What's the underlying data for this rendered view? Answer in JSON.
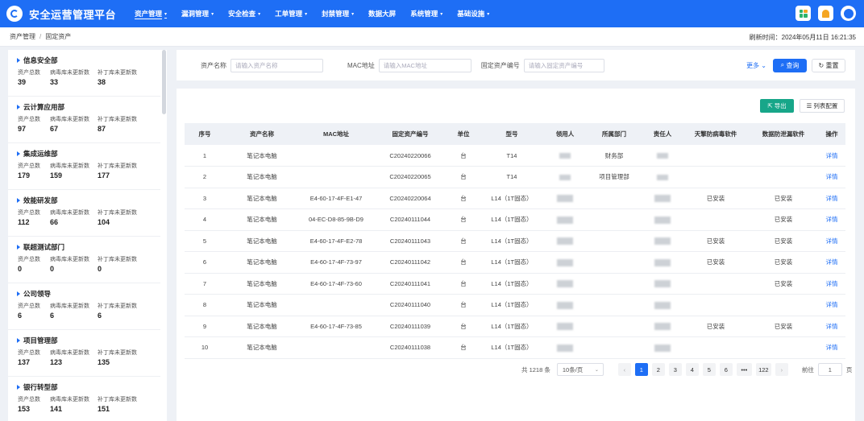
{
  "app": {
    "title": "安全运营管理平台"
  },
  "nav": [
    {
      "label": "资产管理",
      "chevron": true,
      "active": true
    },
    {
      "label": "漏洞管理",
      "chevron": true
    },
    {
      "label": "安全检查",
      "chevron": true
    },
    {
      "label": "工单管理",
      "chevron": true
    },
    {
      "label": "封禁管理",
      "chevron": true
    },
    {
      "label": "数据大屏",
      "chevron": false
    },
    {
      "label": "系统管理",
      "chevron": true
    },
    {
      "label": "基础设施",
      "chevron": true
    }
  ],
  "breadcrumb": {
    "parent": "资产管理",
    "separator": "/",
    "current": "固定资产"
  },
  "refresh": {
    "label": "刷新时间：",
    "time": "2024年05月11日 16:21:35"
  },
  "stat_labels": {
    "total": "资产总数",
    "virus": "病毒库未更新数",
    "patch": "补丁库未更新数"
  },
  "departments": [
    {
      "name": "信息安全部",
      "total": "39",
      "virus": "33",
      "patch": "38"
    },
    {
      "name": "云计算应用部",
      "total": "97",
      "virus": "67",
      "patch": "87"
    },
    {
      "name": "集成运维部",
      "total": "179",
      "virus": "159",
      "patch": "177"
    },
    {
      "name": "效能研发部",
      "total": "112",
      "virus": "66",
      "patch": "104"
    },
    {
      "name": "联超测试部门",
      "total": "0",
      "virus": "0",
      "patch": "0"
    },
    {
      "name": "公司领导",
      "total": "6",
      "virus": "6",
      "patch": "6"
    },
    {
      "name": "项目管理部",
      "total": "137",
      "virus": "123",
      "patch": "135"
    },
    {
      "name": "银行转型部",
      "total": "153",
      "virus": "141",
      "patch": "151"
    }
  ],
  "search": {
    "name_label": "资产名称",
    "name_placeholder": "请输入资产名称",
    "mac_label": "MAC地址",
    "mac_placeholder": "请输入MAC地址",
    "code_label": "固定资产编号",
    "code_placeholder": "请输入固定资产编号",
    "more": "更多",
    "query": "查询",
    "reset": "重置"
  },
  "toolbar": {
    "export": "导出",
    "columns": "列表配置"
  },
  "table": {
    "headers": [
      "序号",
      "资产名称",
      "MAC地址",
      "固定资产编号",
      "单位",
      "型号",
      "领用人",
      "所属部门",
      "责任人",
      "天擎防病毒软件",
      "数据防泄漏软件",
      "操作"
    ],
    "rows": [
      {
        "no": "1",
        "name": "笔记本电脑",
        "mac": "",
        "code": "C20240220066",
        "unit": "台",
        "model": "T14",
        "dept": "财务部",
        "av": "",
        "dlp": "",
        "action": "详情"
      },
      {
        "no": "2",
        "name": "笔记本电脑",
        "mac": "",
        "code": "C20240220065",
        "unit": "台",
        "model": "T14",
        "dept": "项目管理部",
        "av": "",
        "dlp": "",
        "action": "详情"
      },
      {
        "no": "3",
        "name": "笔记本电脑",
        "mac": "E4-60-17-4F-E1-47",
        "code": "C20240220064",
        "unit": "台",
        "model": "L14（1T固态）",
        "dept": "",
        "av": "已安装",
        "dlp": "已安装",
        "action": "详情"
      },
      {
        "no": "4",
        "name": "笔记本电脑",
        "mac": "04-EC-D8-85-9B-D9",
        "code": "C20240111044",
        "unit": "台",
        "model": "L14（1T固态）",
        "dept": "",
        "av": "",
        "dlp": "已安装",
        "action": "详情"
      },
      {
        "no": "5",
        "name": "笔记本电脑",
        "mac": "E4-60-17-4F-E2-78",
        "code": "C20240111043",
        "unit": "台",
        "model": "L14（1T固态）",
        "dept": "",
        "av": "已安装",
        "dlp": "已安装",
        "action": "详情"
      },
      {
        "no": "6",
        "name": "笔记本电脑",
        "mac": "E4-60-17-4F-73-97",
        "code": "C20240111042",
        "unit": "台",
        "model": "L14（1T固态）",
        "dept": "",
        "av": "已安装",
        "dlp": "已安装",
        "action": "详情"
      },
      {
        "no": "7",
        "name": "笔记本电脑",
        "mac": "E4-60-17-4F-73-60",
        "code": "C20240111041",
        "unit": "台",
        "model": "L14（1T固态）",
        "dept": "",
        "av": "",
        "dlp": "已安装",
        "action": "详情"
      },
      {
        "no": "8",
        "name": "笔记本电脑",
        "mac": "",
        "code": "C20240111040",
        "unit": "台",
        "model": "L14（1T固态）",
        "dept": "",
        "av": "",
        "dlp": "",
        "action": "详情"
      },
      {
        "no": "9",
        "name": "笔记本电脑",
        "mac": "E4-60-17-4F-73-85",
        "code": "C20240111039",
        "unit": "台",
        "model": "L14（1T固态）",
        "dept": "",
        "av": "已安装",
        "dlp": "已安装",
        "action": "详情"
      },
      {
        "no": "10",
        "name": "笔记本电脑",
        "mac": "",
        "code": "C20240111038",
        "unit": "台",
        "model": "L14（1T固态）",
        "dept": "",
        "av": "",
        "dlp": "",
        "action": "详情"
      }
    ]
  },
  "pager": {
    "total": "共 1218 条",
    "page_size": "10条/页",
    "pages": [
      "1",
      "2",
      "3",
      "4",
      "5",
      "6",
      "•••",
      "122"
    ],
    "current": "1",
    "goto_label": "前往",
    "goto_value": "1",
    "goto_suffix": "页"
  },
  "colors": {
    "primary": "#1e6ef5",
    "export": "#17a689"
  }
}
